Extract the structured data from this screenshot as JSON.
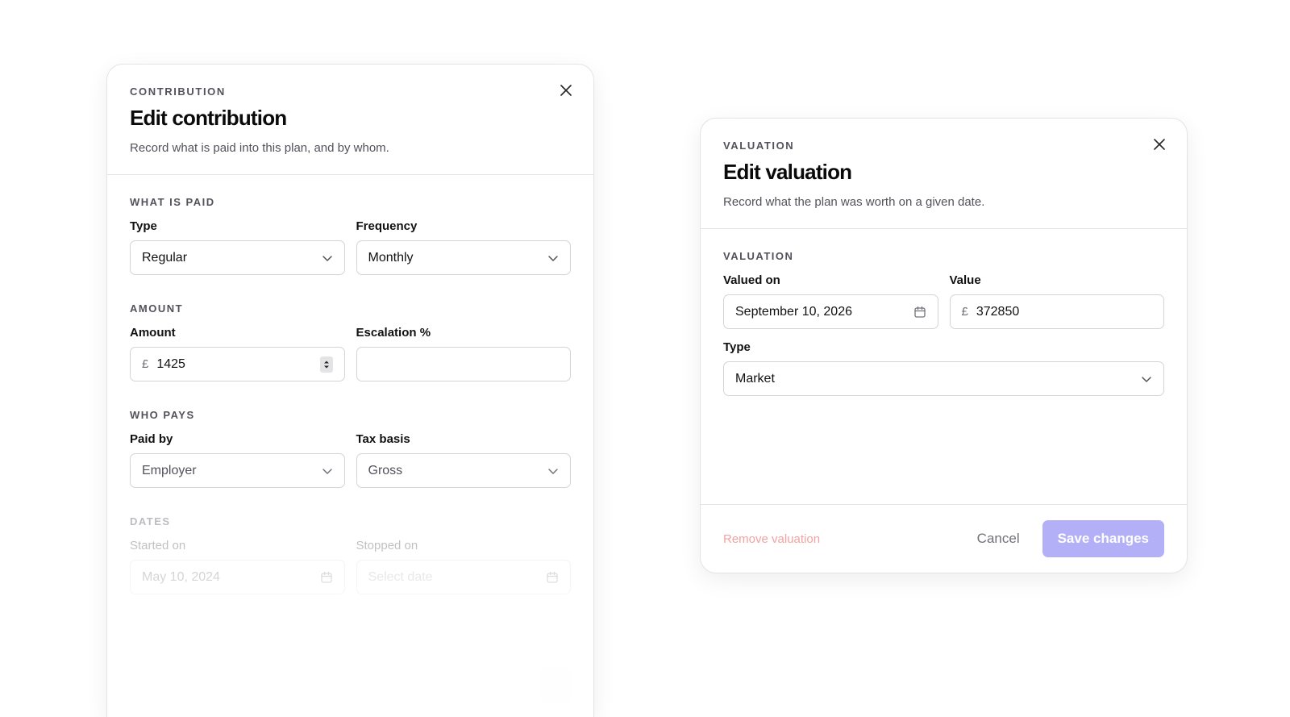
{
  "contribution": {
    "eyebrow": "CONTRIBUTION",
    "title": "Edit contribution",
    "description": "Record what is paid into this plan, and by whom.",
    "sections": {
      "what_is_paid": "WHAT IS PAID",
      "amount": "AMOUNT",
      "who_pays": "WHO PAYS",
      "dates": "DATES"
    },
    "type": {
      "label": "Type",
      "value": "Regular"
    },
    "frequency": {
      "label": "Frequency",
      "value": "Monthly"
    },
    "amount": {
      "label": "Amount",
      "currency": "£",
      "value": "1425"
    },
    "escalation": {
      "label": "Escalation %",
      "value": ""
    },
    "paid_by": {
      "label": "Paid by",
      "value": "Employer"
    },
    "tax_basis": {
      "label": "Tax basis",
      "value": "Gross"
    },
    "started_on": {
      "label": "Started on",
      "value": "May 10, 2024"
    },
    "stopped_on": {
      "label": "Stopped on",
      "placeholder": "Select date"
    }
  },
  "valuation": {
    "eyebrow": "VALUATION",
    "title": "Edit valuation",
    "description": "Record what the plan was worth on a given date.",
    "section": "VALUATION",
    "valued_on": {
      "label": "Valued on",
      "value": "September 10, 2026"
    },
    "value": {
      "label": "Value",
      "currency": "£",
      "value": "372850"
    },
    "type": {
      "label": "Type",
      "value": "Market"
    },
    "footer": {
      "remove": "Remove valuation",
      "cancel": "Cancel",
      "save": "Save changes"
    }
  },
  "colors": {
    "accent_disabled": "#b4b0f7",
    "danger_faded": "#f2a3a3",
    "border": "#e4e4e7"
  },
  "icons": [
    "close-icon",
    "chevron-down-icon",
    "calendar-icon",
    "stepper-icon"
  ]
}
